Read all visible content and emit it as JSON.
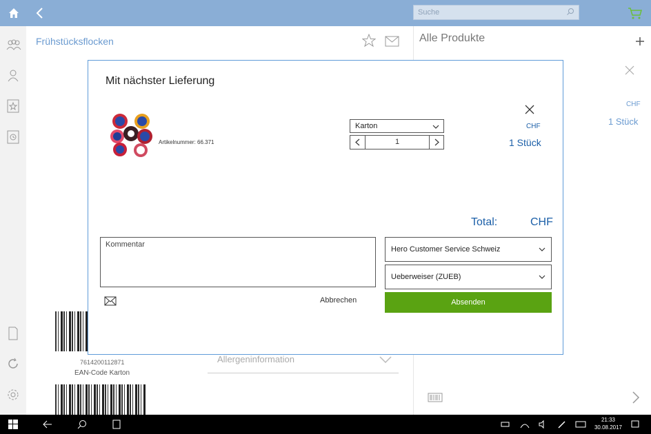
{
  "topbar": {
    "search_placeholder": "Suche",
    "colors": {
      "bar": "#8aaed6"
    }
  },
  "icons": [
    "home-icon",
    "back-icon",
    "search-icon",
    "cart-icon",
    "customers-icon",
    "user-icon",
    "favorites-icon",
    "history-icon",
    "document-icon",
    "sync-icon",
    "settings-icon",
    "star-icon",
    "mail-icon",
    "plus-icon",
    "close-icon",
    "barcode-icon",
    "chevron-right-icon"
  ],
  "background": {
    "product_title": "Frühstücksflocken",
    "right_title": "Alle Produkte",
    "right_currency": "CHF",
    "right_qty": "1 Stück",
    "ean_number": "7614200112871",
    "ean_label": "EAN-Code Karton",
    "allergen_label": "Allergeninformation"
  },
  "modal": {
    "title": "Mit nächster Lieferung",
    "article_number": "Artikelnummer:  66.371",
    "unit_select": "Karton",
    "quantity": "1",
    "currency": "CHF",
    "qty_label": "1 Stück",
    "total_label": "Total:",
    "total_currency": "CHF",
    "comment_placeholder": "Kommentar",
    "recipient": "Hero Customer Service Schweiz",
    "payment": "Ueberweiser (ZUEB)",
    "cancel_label": "Abbrechen",
    "send_label": "Absenden",
    "colors": {
      "accent": "#1b5fa8",
      "send": "#5aa312",
      "border": "#5e9bd8"
    }
  },
  "taskbar": {
    "time": "21:33",
    "date": "30.08.2017"
  }
}
